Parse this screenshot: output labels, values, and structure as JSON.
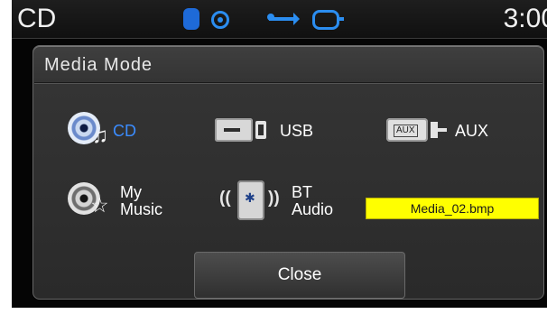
{
  "status_bar": {
    "source": "CD",
    "time": "3:00",
    "icons": [
      "bluetooth-icon",
      "disc-icon",
      "usb-icon",
      "ipod-icon"
    ]
  },
  "dialog": {
    "title": "Media Mode",
    "options": [
      {
        "id": "cd",
        "label": "CD",
        "icon": "cd-icon",
        "selected": true
      },
      {
        "id": "usb",
        "label": "USB",
        "icon": "usb-icon",
        "selected": false
      },
      {
        "id": "aux",
        "label": "AUX",
        "icon": "aux-icon",
        "selected": false
      },
      {
        "id": "my-music",
        "label": "My\nMusic",
        "icon": "my-music-icon",
        "selected": false
      },
      {
        "id": "bt-audio",
        "label": "BT\nAudio",
        "icon": "bluetooth-phone-icon",
        "selected": false
      }
    ],
    "aux_icon_text": "AUX",
    "close_label": "Close"
  },
  "file_label": "Media_02.bmp",
  "colors": {
    "selected": "#3b8cff",
    "highlight": "#ffff00",
    "panel": "#343434"
  }
}
